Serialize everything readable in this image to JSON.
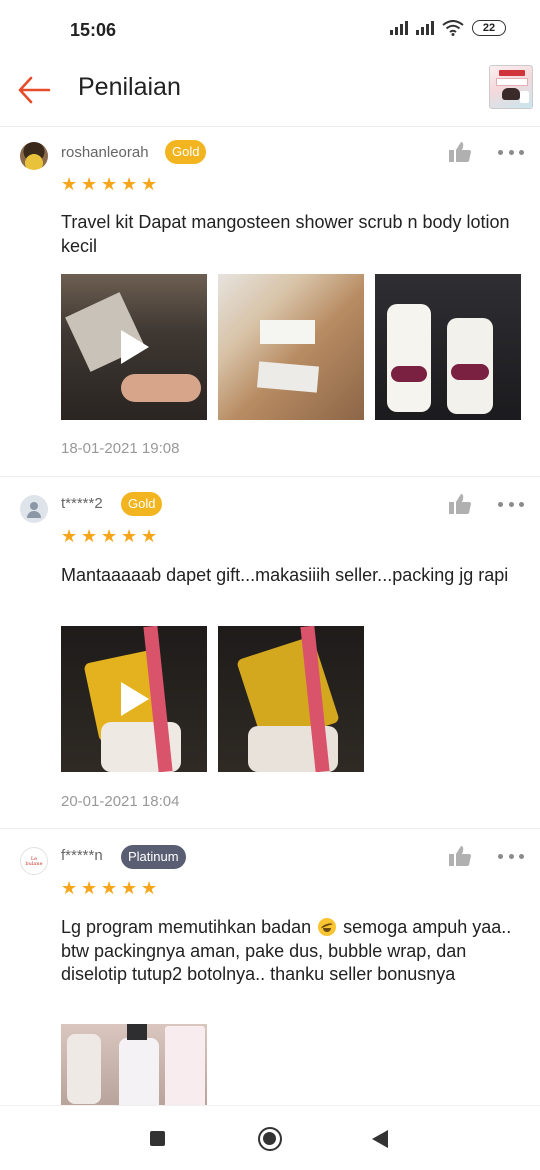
{
  "status_bar": {
    "time": "15:06",
    "battery": "22"
  },
  "header": {
    "title": "Penilaian",
    "back_icon": "arrow-left-icon",
    "accent_color": "#e74c2a"
  },
  "reviews": [
    {
      "username": "roshanleorah",
      "tier": "Gold",
      "rating": 5,
      "text": "Travel kit Dapat mangosteen shower scrub n body lotion kecil",
      "media": [
        "video",
        "image",
        "image"
      ],
      "date": "18-01-2021 19:08"
    },
    {
      "username": "t*****2",
      "tier": "Gold",
      "rating": 5,
      "text": "Mantaaaaab dapet gift...makasiiih seller...packing jg rapi",
      "media": [
        "video",
        "image"
      ],
      "date": "20-01-2021 18:04"
    },
    {
      "username": "f*****n",
      "tier": "Platinum",
      "rating": 5,
      "text_before_emoji": "Lg program memutihkan badan",
      "text_after_emoji": " semoga ampuh yaa.. btw packingnya aman, pake dus, bubble wrap, dan diselotip tutup2 botolnya.. thanku seller bonusnya",
      "media": [
        "image"
      ]
    }
  ],
  "colors": {
    "gold_badge": "#f2b51f",
    "platinum_badge": "#5a5e73",
    "star": "#f7a51b"
  }
}
